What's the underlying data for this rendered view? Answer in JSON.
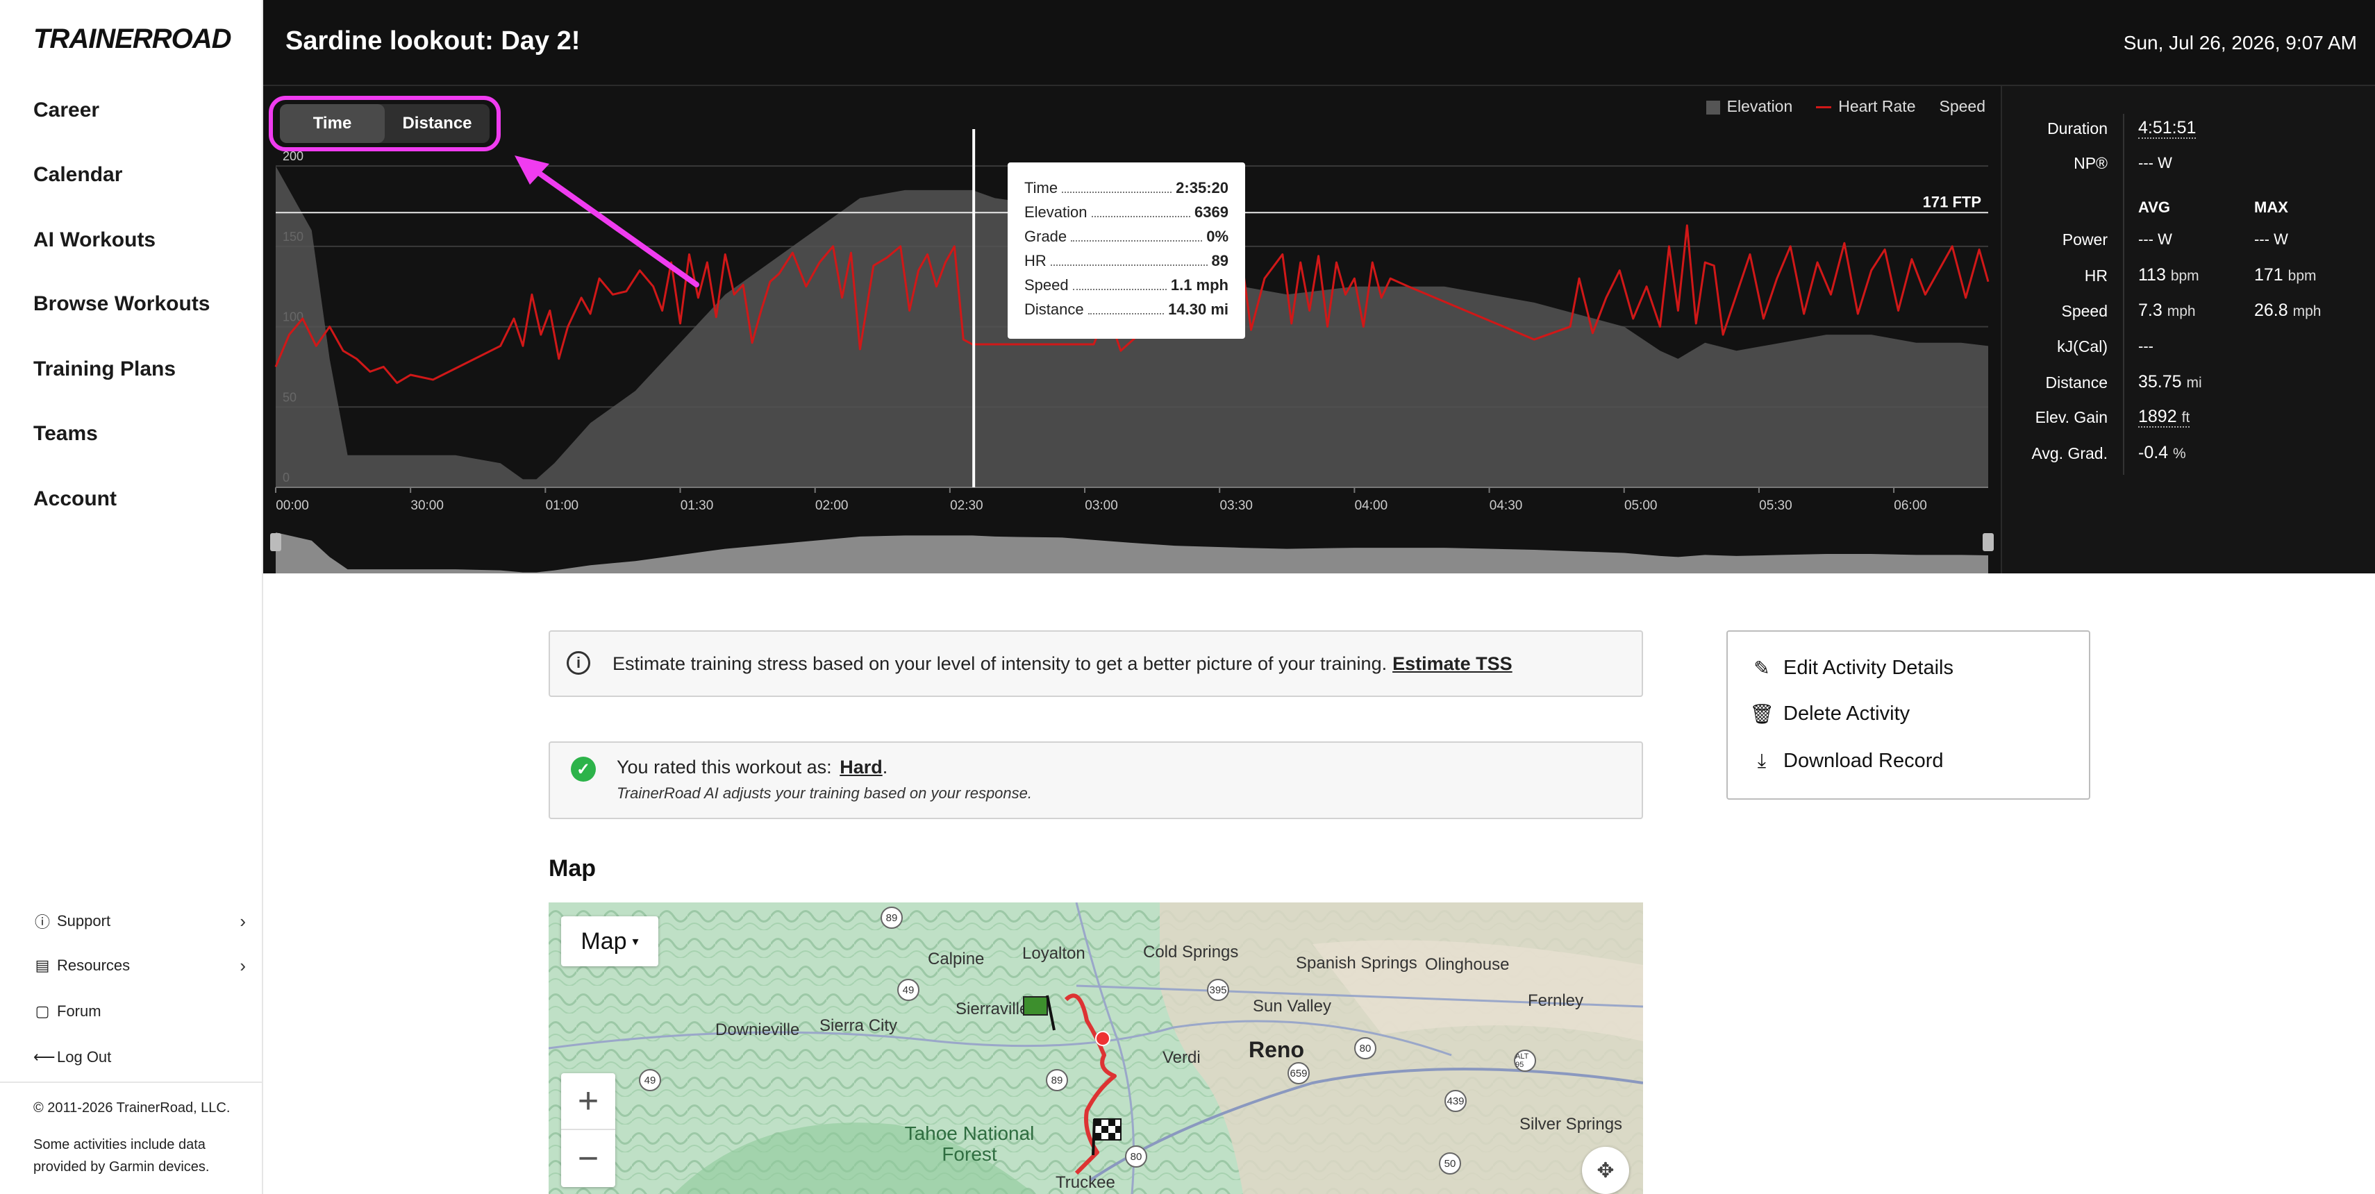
{
  "sidebar": {
    "logo": "TRAINERROAD",
    "nav": [
      "Career",
      "Calendar",
      "AI Workouts",
      "Browse Workouts",
      "Training Plans",
      "Teams",
      "Account"
    ],
    "support": "Support",
    "resources": "Resources",
    "forum": "Forum",
    "logout": "Log Out",
    "copyright": "© 2011-2026 TrainerRoad, LLC.",
    "garmin": "Some activities include data provided by Garmin devices."
  },
  "header": {
    "title": "Sardine lookout: Day 2!",
    "datetime": "Sun, Jul 26, 2026, 9:07 AM"
  },
  "chart": {
    "toggle": {
      "time": "Time",
      "distance": "Distance",
      "active": "Time"
    },
    "legend": {
      "elevation": "Elevation",
      "heart_rate": "Heart Rate",
      "speed": "Speed"
    },
    "ftp_label": "171 FTP",
    "colors": {
      "heart_rate": "#d01818",
      "elevation": "#555555",
      "background": "#121212",
      "highlight": "#f03cf0"
    },
    "tooltip": [
      {
        "k": "Time",
        "v": "2:35:20"
      },
      {
        "k": "Elevation",
        "v": "6369"
      },
      {
        "k": "Grade",
        "v": "0%"
      },
      {
        "k": "HR",
        "v": "89"
      },
      {
        "k": "Speed",
        "v": "1.1 mph"
      },
      {
        "k": "Distance",
        "v": "14.30 mi"
      }
    ]
  },
  "chart_data": {
    "type": "line",
    "title": "",
    "xlabel": "",
    "ylabel": "",
    "x_ticks": [
      "00:00",
      "30:00",
      "01:00",
      "01:30",
      "02:00",
      "02:30",
      "03:00",
      "03:30",
      "04:00",
      "04:30",
      "05:00",
      "05:30",
      "06:00"
    ],
    "y_ticks": [
      "0",
      "50",
      "100",
      "150",
      "200"
    ],
    "ylim": [
      0,
      210
    ],
    "xlim_minutes": [
      0,
      381
    ],
    "ftp_line": 171,
    "cursor_minutes": 155.3,
    "series": [
      {
        "name": "Heart Rate",
        "x_minutes": [
          0,
          3,
          6,
          9,
          12,
          15,
          18,
          21,
          24,
          27,
          30,
          35,
          40,
          50,
          53,
          55,
          57,
          59,
          61,
          63,
          65,
          68,
          70,
          72,
          75,
          78,
          81,
          84,
          86,
          88,
          90,
          92,
          94,
          96,
          98,
          100,
          102,
          104,
          106,
          108,
          110,
          112,
          115,
          118,
          121,
          124,
          126,
          128,
          130,
          133,
          136,
          139,
          141,
          143,
          145,
          147,
          149,
          151,
          153,
          155,
          160,
          170,
          182,
          185,
          188,
          192,
          196,
          200,
          210,
          213,
          215,
          217,
          220,
          224,
          226,
          228,
          230,
          232,
          234,
          236,
          238,
          240,
          242,
          244,
          246,
          248,
          252,
          280,
          288,
          290,
          293,
          296,
          299,
          302,
          305,
          308,
          310,
          312,
          314,
          316,
          318,
          320,
          322,
          325,
          328,
          331,
          334,
          337,
          340,
          343,
          346,
          349,
          352,
          355,
          358,
          361,
          364,
          367,
          370,
          373,
          376,
          379,
          381
        ],
        "y": [
          75,
          95,
          105,
          88,
          100,
          85,
          80,
          72,
          75,
          65,
          70,
          67,
          74,
          88,
          105,
          88,
          120,
          95,
          110,
          80,
          100,
          118,
          108,
          130,
          120,
          122,
          135,
          125,
          110,
          140,
          102,
          145,
          118,
          140,
          106,
          145,
          120,
          126,
          90,
          110,
          128,
          133,
          146,
          125,
          140,
          150,
          118,
          146,
          86,
          138,
          143,
          150,
          110,
          135,
          145,
          125,
          140,
          150,
          92,
          89,
          89,
          89,
          89,
          110,
          85,
          95,
          120,
          108,
          95,
          125,
          140,
          98,
          130,
          145,
          102,
          140,
          110,
          144,
          100,
          140,
          120,
          130,
          100,
          140,
          118,
          130,
          125,
          92,
          100,
          130,
          96,
          118,
          135,
          105,
          125,
          100,
          150,
          110,
          163,
          102,
          140,
          138,
          95,
          120,
          145,
          105,
          130,
          150,
          108,
          140,
          120,
          152,
          108,
          135,
          148,
          110,
          142,
          120,
          135,
          150,
          118,
          148,
          128
        ]
      },
      {
        "name": "Elevation",
        "x_minutes": [
          0,
          8,
          12,
          16,
          20,
          40,
          50,
          55,
          58,
          62,
          70,
          80,
          90,
          100,
          110,
          120,
          130,
          140,
          150,
          155,
          160,
          165,
          175,
          190,
          200,
          215,
          225,
          240,
          260,
          280,
          300,
          308,
          312,
          318,
          325,
          335,
          345,
          355,
          365,
          375,
          381
        ],
        "y": [
          200,
          160,
          80,
          20,
          20,
          20,
          15,
          5,
          5,
          15,
          40,
          60,
          90,
          120,
          140,
          160,
          180,
          185,
          185,
          185,
          180,
          178,
          175,
          150,
          135,
          125,
          120,
          125,
          125,
          115,
          100,
          85,
          80,
          90,
          85,
          90,
          95,
          95,
          90,
          90,
          88
        ]
      }
    ]
  },
  "stats": {
    "duration_label": "Duration",
    "duration": "4:51:51",
    "np_label": "NP®",
    "np": "--- W",
    "avg_head": "AVG",
    "max_head": "MAX",
    "power_label": "Power",
    "power_avg": "--- W",
    "power_max": "--- W",
    "hr_label": "HR",
    "hr_avg": "113",
    "hr_max": "171",
    "hr_unit": "bpm",
    "speed_label": "Speed",
    "speed_avg": "7.3",
    "speed_max": "26.8",
    "speed_unit": "mph",
    "kj_label": "kJ(Cal)",
    "kj": "---",
    "distance_label": "Distance",
    "distance": "35.75",
    "distance_unit": "mi",
    "elev_label": "Elev. Gain",
    "elev": "1892",
    "elev_unit": "ft",
    "grade_label": "Avg. Grad.",
    "grade": "-0.4",
    "grade_unit": "%"
  },
  "content": {
    "info_text": "Estimate training stress based on your level of intensity to get a better picture of your training.",
    "info_link": "Estimate TSS",
    "rated_prefix": "You rated this workout as:",
    "rated_value": "Hard",
    "rated_sub": "TrainerRoad AI adjusts your training based on your response.",
    "actions": {
      "edit": "Edit Activity Details",
      "delete": "Delete Activity",
      "download": "Download Record"
    },
    "map_title": "Map",
    "map_type": "Map"
  },
  "map_labels": {
    "places": [
      "Loyalton",
      "Calpine",
      "Cold Springs",
      "Spanish Springs",
      "Olinghouse",
      "Sierraville",
      "Sun Valley",
      "Fernley",
      "Downieville",
      "Sierra City",
      "Reno",
      "Verdi",
      "Tahoe National Forest",
      "Silver Springs",
      "Truckee"
    ],
    "roads": [
      "89",
      "49",
      "395",
      "80",
      "659",
      "ALT 95",
      "439",
      "50",
      "49",
      "89",
      "80"
    ]
  }
}
